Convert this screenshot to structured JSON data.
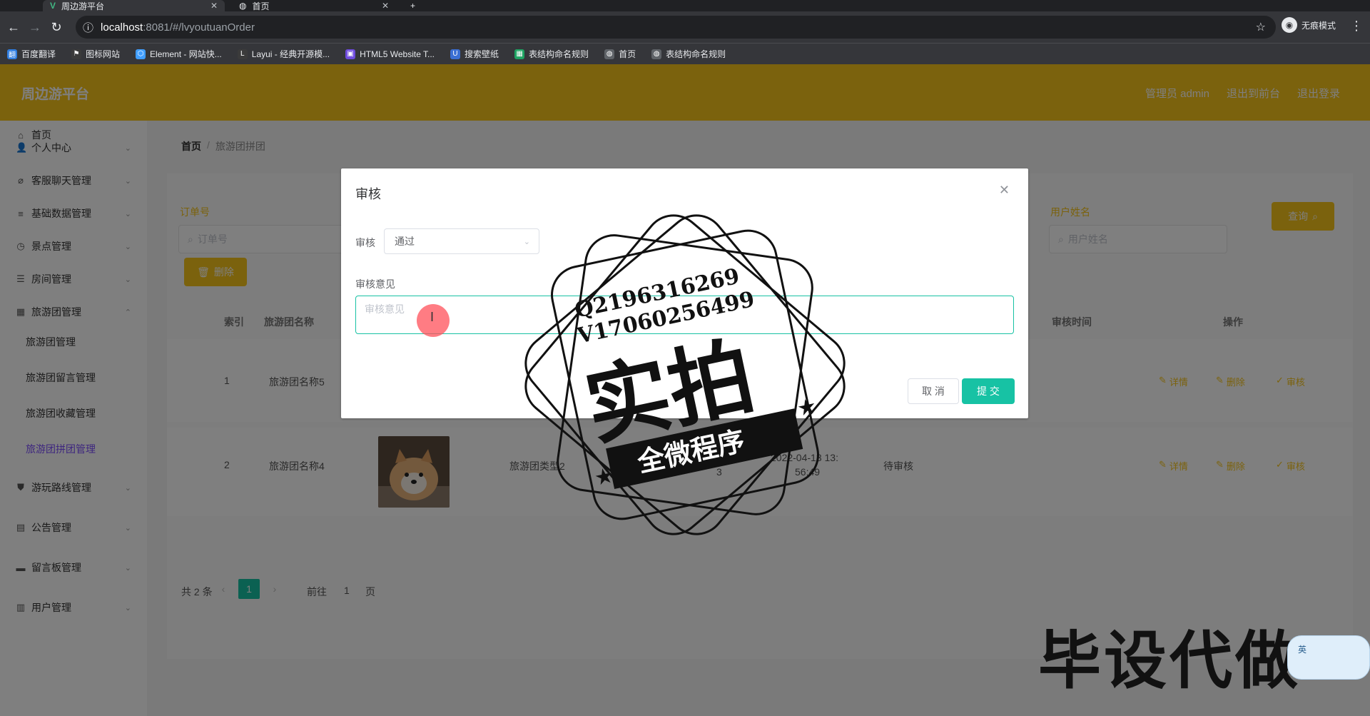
{
  "browser": {
    "tabs": [
      {
        "title": "周边游平台",
        "active": true
      },
      {
        "title": "首页",
        "active": false
      }
    ],
    "url_host": "localhost",
    "url_path": ":8081/#/lvyoutuanOrder",
    "incognito_label": "无痕模式",
    "bookmarks": [
      {
        "label": "百度翻译",
        "color": "#2f7de1",
        "icon": "翻"
      },
      {
        "label": "图标网站",
        "color": "#3b3b3b",
        "icon": "⚑"
      },
      {
        "label": "Element - 网站快...",
        "color": "#409eff",
        "icon": "⬡"
      },
      {
        "label": "Layui - 经典开源模...",
        "color": "#3b3b3b",
        "icon": "L"
      },
      {
        "label": "HTML5 Website T...",
        "color": "#6f4cde",
        "icon": "▣"
      },
      {
        "label": "搜索壁纸",
        "color": "#3b6fd4",
        "icon": "U"
      },
      {
        "label": "表结构命名规则",
        "color": "#1fa463",
        "icon": "▦"
      },
      {
        "label": "首页",
        "color": "#5f6368",
        "icon": "◍"
      },
      {
        "label": "表结构命名规则",
        "color": "#5f6368",
        "icon": "◍"
      }
    ]
  },
  "header": {
    "brand": "周边游平台",
    "links": [
      "管理员 admin",
      "退出到前台",
      "退出登录"
    ]
  },
  "sidebar": {
    "items": [
      {
        "label": "首页",
        "icon": "⌂"
      },
      {
        "label": "个人中心",
        "icon": "👤"
      },
      {
        "label": "客服聊天管理",
        "icon": "⌀"
      },
      {
        "label": "基础数据管理",
        "icon": "≡"
      },
      {
        "label": "景点管理",
        "icon": "◷"
      },
      {
        "label": "房间管理",
        "icon": "☰"
      },
      {
        "label": "旅游团管理",
        "icon": "▦"
      }
    ],
    "subitems": [
      "旅游团管理",
      "旅游团留言管理",
      "旅游团收藏管理",
      "旅游团拼团管理"
    ],
    "items_after": [
      {
        "label": "游玩路线管理",
        "icon": "⛊"
      },
      {
        "label": "公告管理",
        "icon": "▤"
      },
      {
        "label": "留言板管理",
        "icon": "▬"
      },
      {
        "label": "用户管理",
        "icon": "▥"
      }
    ]
  },
  "breadcrumb": {
    "home": "首页",
    "current": "旅游团拼团"
  },
  "filters": {
    "order_label": "订单号",
    "order_placeholder": "订单号",
    "user_label": "用户姓名",
    "user_placeholder": "用户姓名",
    "search_button": "查询",
    "delete_button": "删除"
  },
  "table": {
    "headers": [
      "索引",
      "旅游团名称",
      "审核时间",
      "操作"
    ],
    "rows": [
      {
        "index": "1",
        "name": "旅游团名称5",
        "type": "",
        "code": "",
        "time": "",
        "status": ""
      },
      {
        "index": "2",
        "name": "旅游团名称4",
        "type": "旅游团类型2",
        "code_a": "10896",
        "code_b": "3",
        "time_a": "2022-04-13 13:",
        "time_b": "56:49",
        "status": "待审核"
      }
    ],
    "ops": [
      "详情",
      "删除",
      "审核"
    ]
  },
  "pagination": {
    "total": "共 2 条",
    "current": "1",
    "goto": "前往",
    "goto_value": "1",
    "page": "页"
  },
  "dialog": {
    "title": "审核",
    "review_label": "审核",
    "review_value": "通过",
    "opinion_label": "审核意见",
    "opinion_placeholder": "审核意见",
    "cancel": "取 消",
    "submit": "提 交"
  },
  "watermark": {
    "line1": "Q2196316269",
    "line2": "V17060256499",
    "big": "实拍",
    "ribbon": "全微程序",
    "corner": "毕设代做",
    "ime": "英"
  }
}
